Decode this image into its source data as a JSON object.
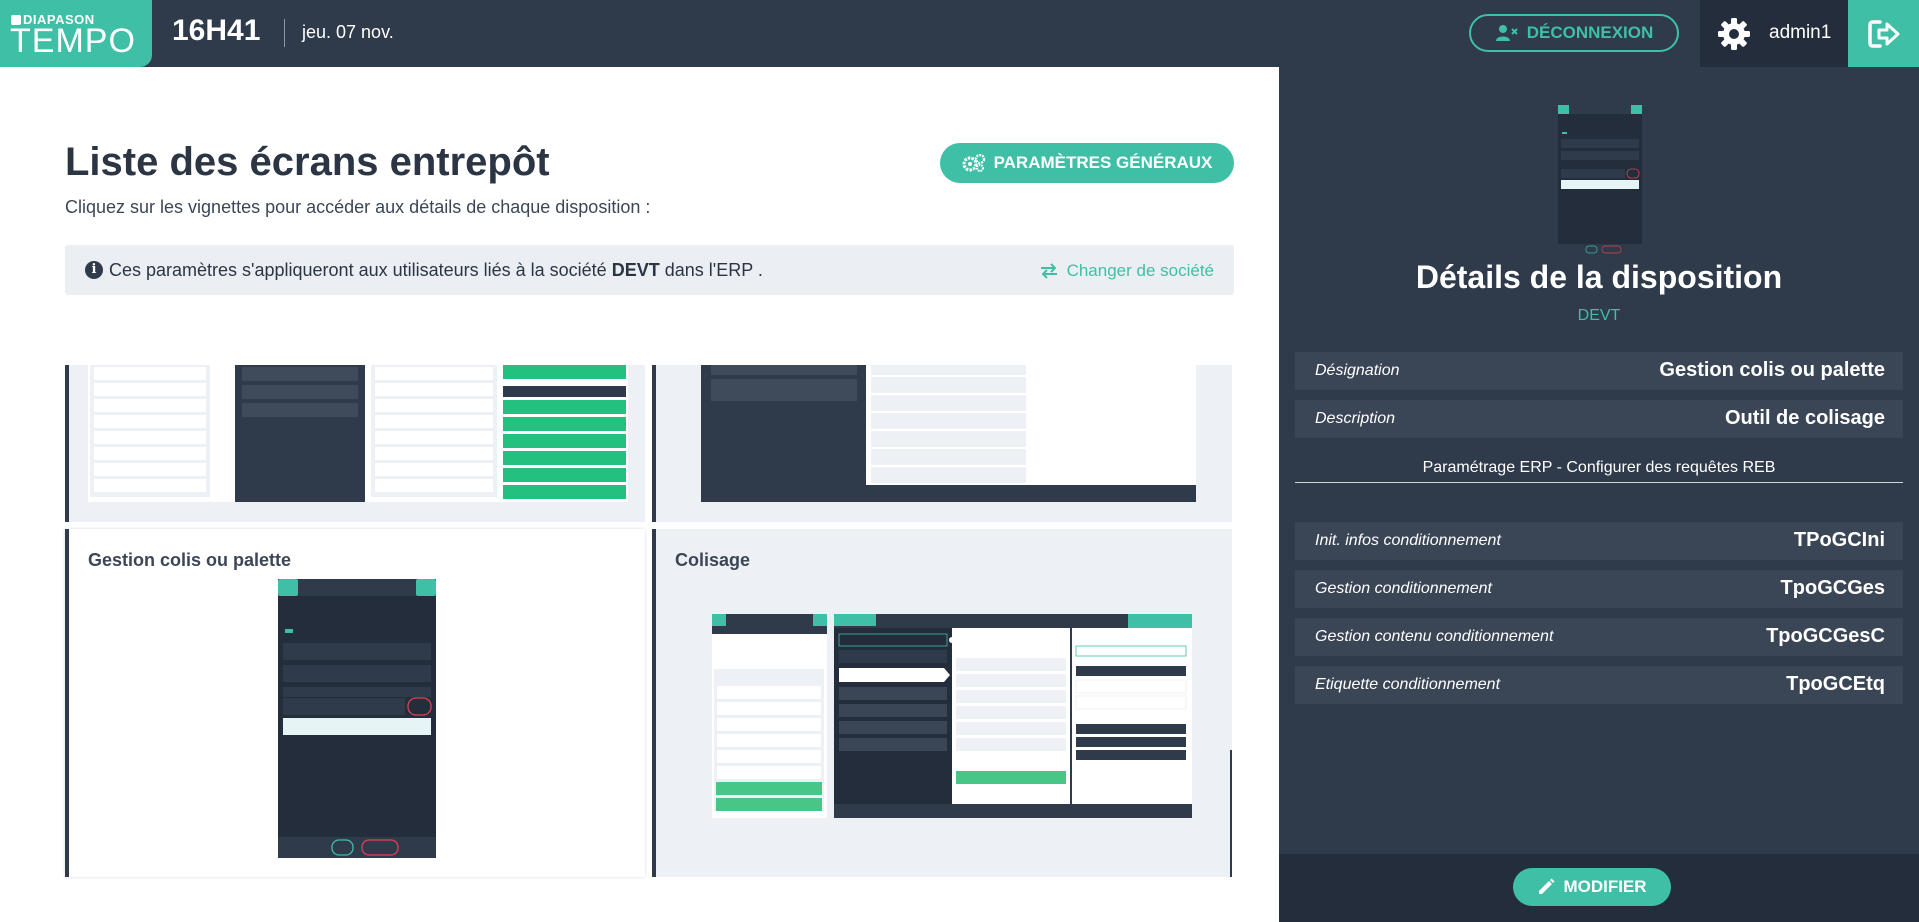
{
  "header": {
    "brand_small": "DIAPASON",
    "brand_big": "TEMPO",
    "time": "16H41",
    "date": "jeu. 07 nov.",
    "logout_label": "DÉCONNEXION",
    "username": "admin1"
  },
  "main": {
    "title": "Liste des écrans entrepôt",
    "subtitle": "Cliquez sur les vignettes pour accéder aux détails de chaque disposition :",
    "params_button": "PARAMÈTRES GÉNÉRAUX",
    "info": {
      "text_before": "Ces paramètres s'appliqueront aux utilisateurs liés à la société ",
      "company": "DEVT",
      "text_after": " dans l'ERP .",
      "change_label": "Changer de société"
    },
    "cards": [
      {
        "title": ""
      },
      {
        "title": ""
      },
      {
        "title": "Gestion colis ou palette"
      },
      {
        "title": "Colisage"
      }
    ]
  },
  "details": {
    "title": "Détails de la disposition",
    "company": "DEVT",
    "fields": [
      {
        "label": "Désignation",
        "value": "Gestion colis ou palette"
      },
      {
        "label": "Description",
        "value": "Outil de colisage"
      }
    ],
    "erp_section": "Paramétrage ERP - Configurer des requêtes REB",
    "requests": [
      {
        "label": "Init. infos conditionnement",
        "value": "TPoGCIni"
      },
      {
        "label": "Gestion conditionnement",
        "value": "TpoGCGes"
      },
      {
        "label": "Gestion contenu conditionnement",
        "value": "TpoGCGesC"
      },
      {
        "label": "Etiquette conditionnement",
        "value": "TpoGCEtq"
      }
    ],
    "modify_label": "MODIFIER"
  },
  "colors": {
    "accent": "#3fbfa5",
    "dark": "#2f3a4a",
    "darker": "#232d3c"
  }
}
